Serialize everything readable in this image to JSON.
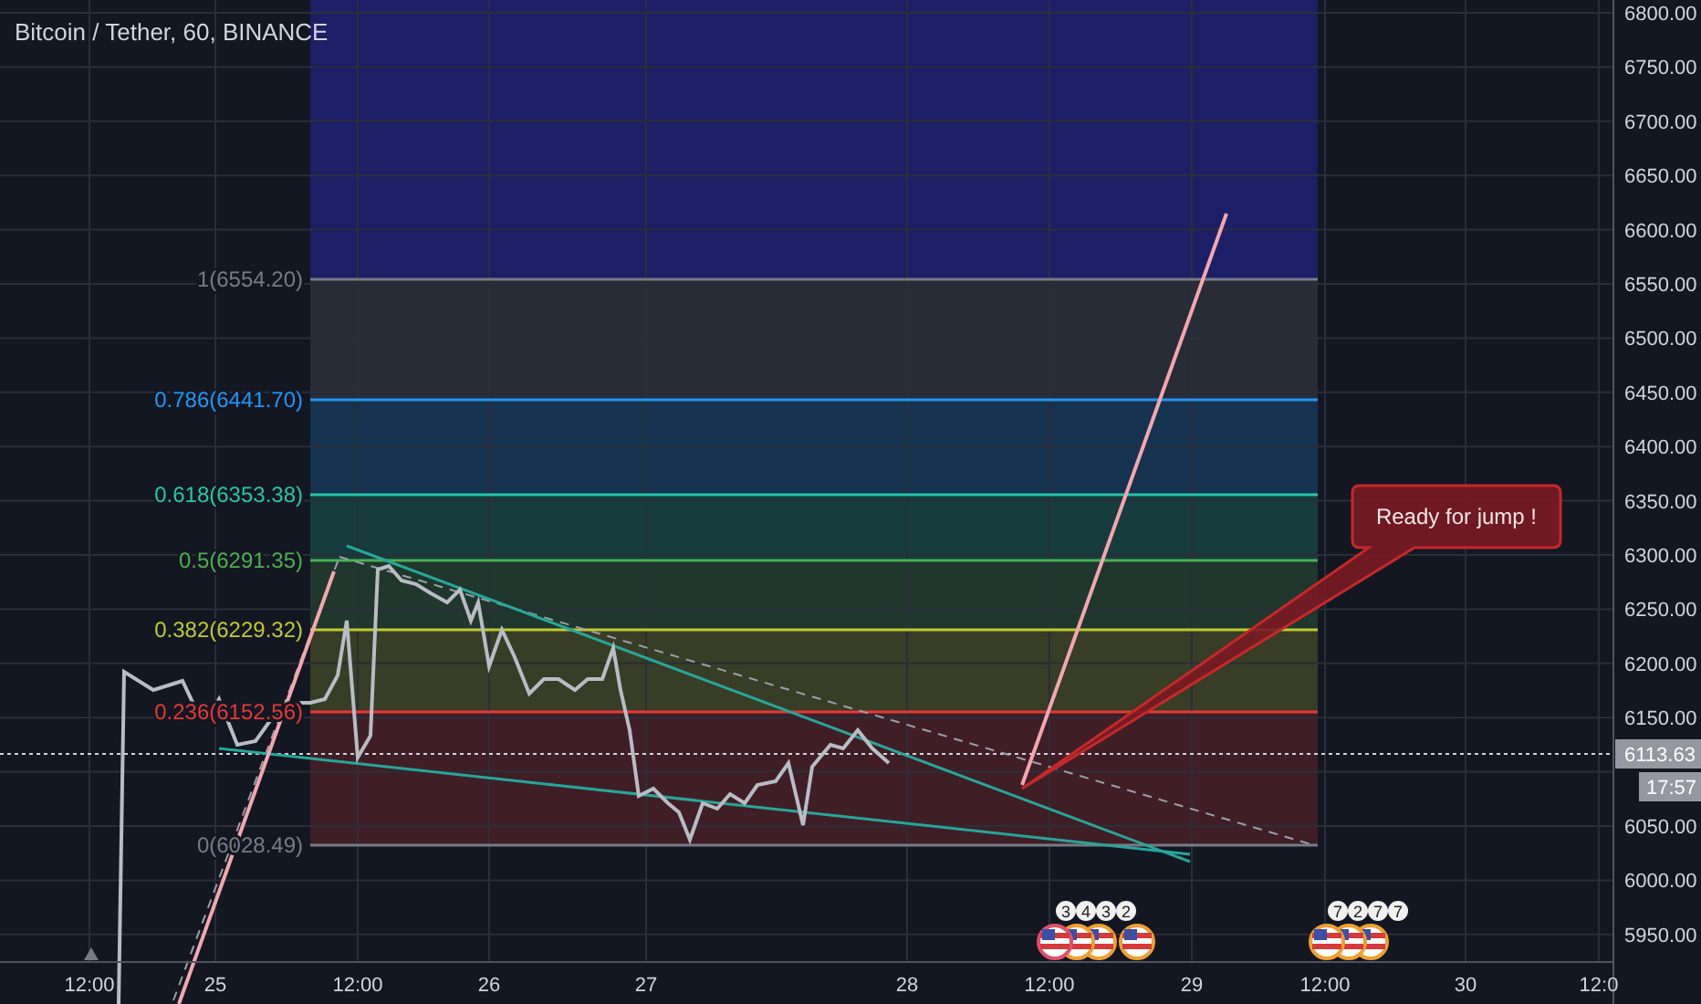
{
  "chart": {
    "title": "Bitcoin / Tether, 60, BINANCE",
    "price_axis": [
      "6800.00",
      "6750.00",
      "6700.00",
      "6650.00",
      "6600.00",
      "6550.00",
      "6500.00",
      "6450.00",
      "6400.00",
      "6350.00",
      "6300.00",
      "6250.00",
      "6200.00",
      "6150.00",
      "6050.00",
      "6000.00",
      "5950.00"
    ],
    "time_axis": [
      "12:00",
      "25",
      "12:00",
      "26",
      "27",
      "28",
      "12:00",
      "29",
      "12:00",
      "30",
      "12:0"
    ],
    "fib_levels": [
      {
        "label": "1(6554.20)",
        "color": "#787b86"
      },
      {
        "label": "0.786(6441.70)",
        "color": "#2196f3"
      },
      {
        "label": "0.618(6353.38)",
        "color": "#26c6a6"
      },
      {
        "label": "0.5(6291.35)",
        "color": "#4caf50"
      },
      {
        "label": "0.382(6229.32)",
        "color": "#c0ca33"
      },
      {
        "label": "0.236(6152.56)",
        "color": "#e53935"
      },
      {
        "label": "0(6028.49)",
        "color": "#787b86"
      }
    ],
    "callout": "Ready for jump !",
    "last_price": "6113.63",
    "countdown": "17:57",
    "events": [
      {
        "color": "#e0506a",
        "badges": [
          "3",
          "4",
          "3",
          "2"
        ]
      },
      {
        "color": "#f0a030"
      },
      {
        "color": "#f0a030",
        "badges": [
          "7",
          "2",
          "7",
          "7"
        ]
      }
    ]
  }
}
